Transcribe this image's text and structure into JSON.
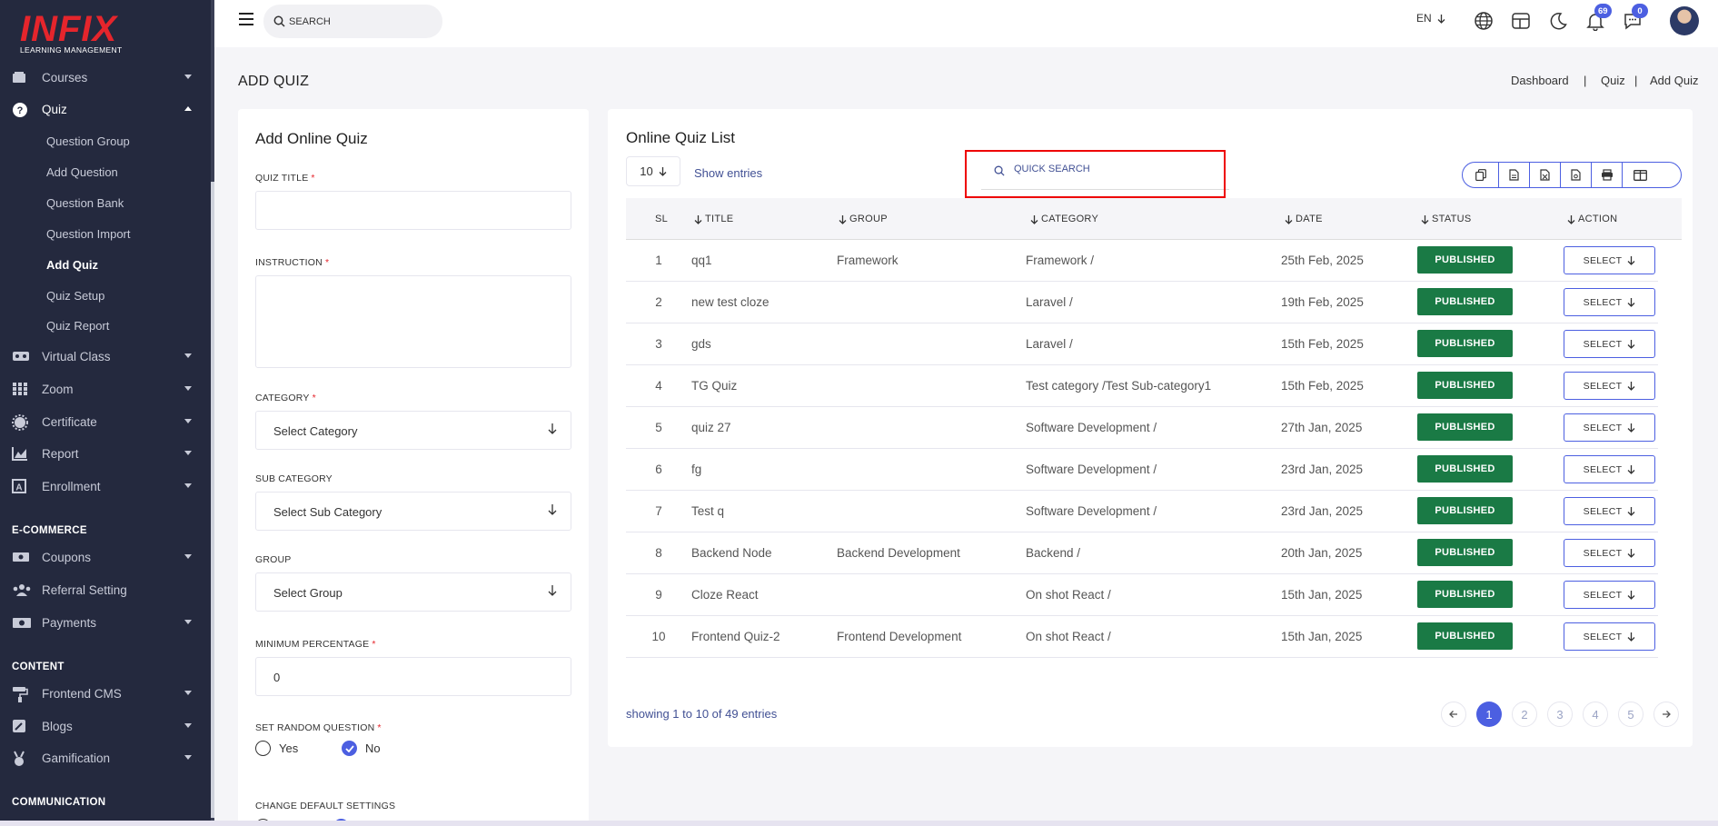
{
  "app": {
    "logo_main": "INFIX",
    "logo_sub": "LEARNING MANAGEMENT"
  },
  "colors": {
    "sidebar_bg": "#24293e",
    "accent": "#4c5fe1",
    "published": "#1a7a45",
    "logo_red": "#e5252c",
    "highlight": "#ee0000"
  },
  "sidebar": {
    "items": [
      {
        "label": "Courses",
        "icon": "courses-icon"
      },
      {
        "label": "Quiz",
        "icon": "quiz-icon",
        "expanded": true
      },
      {
        "label": "Virtual Class",
        "icon": "virtual-class-icon"
      },
      {
        "label": "Zoom",
        "icon": "zoom-icon"
      },
      {
        "label": "Certificate",
        "icon": "certificate-icon"
      },
      {
        "label": "Report",
        "icon": "report-icon"
      },
      {
        "label": "Enrollment",
        "icon": "enrollment-icon"
      },
      {
        "label": "Coupons",
        "icon": "coupons-icon"
      },
      {
        "label": "Referral Setting",
        "icon": "referral-icon"
      },
      {
        "label": "Payments",
        "icon": "payments-icon"
      },
      {
        "label": "Frontend CMS",
        "icon": "frontend-cms-icon"
      },
      {
        "label": "Blogs",
        "icon": "blogs-icon"
      },
      {
        "label": "Gamification",
        "icon": "gamification-icon"
      }
    ],
    "quiz_sub": [
      "Question Group",
      "Add Question",
      "Question Bank",
      "Question Import",
      "Add Quiz",
      "Quiz Setup",
      "Quiz Report"
    ],
    "active_sub": "Add Quiz",
    "sections": {
      "ecommerce": "E-COMMERCE",
      "content": "CONTENT",
      "communication": "COMMUNICATION"
    }
  },
  "header": {
    "search_placeholder": "SEARCH",
    "language": "EN",
    "notifications_count": "69",
    "messages_count": "0"
  },
  "page": {
    "title": "ADD QUIZ",
    "breadcrumb": [
      "Dashboard",
      "Quiz",
      "Add Quiz"
    ],
    "breadcrumb_sep": "|"
  },
  "form": {
    "title": "Add Online Quiz",
    "quiz_title_label": "QUIZ TITLE",
    "instruction_label": "INSTRUCTION",
    "category_label": "CATEGORY",
    "category_value": "Select Category",
    "subcategory_label": "SUB CATEGORY",
    "subcategory_value": "Select Sub Category",
    "group_label": "GROUP",
    "group_value": "Select Group",
    "min_percentage_label": "MINIMUM PERCENTAGE",
    "min_percentage_value": "0",
    "random_label": "SET RANDOM QUESTION",
    "random_yes": "Yes",
    "random_no": "No",
    "random_selected": "No",
    "change_default_label": "CHANGE DEFAULT SETTINGS",
    "required_mark": "*"
  },
  "list": {
    "title": "Online Quiz List",
    "page_length": "10",
    "show_entries": "Show entries",
    "quick_search_placeholder": "QUICK SEARCH",
    "tool_icons": [
      "copy-icon",
      "csv-icon",
      "excel-icon",
      "pdf-icon",
      "print-icon",
      "columns-icon"
    ],
    "columns": [
      "SL",
      "TITLE",
      "GROUP",
      "CATEGORY",
      "DATE",
      "STATUS",
      "ACTION"
    ],
    "rows": [
      {
        "sl": "1",
        "title": "qq1",
        "group": "Framework",
        "category": "Framework /",
        "date": "25th Feb, 2025",
        "status": "PUBLISHED",
        "action": "SELECT"
      },
      {
        "sl": "2",
        "title": "new test cloze",
        "group": "",
        "category": "Laravel /",
        "date": "19th Feb, 2025",
        "status": "PUBLISHED",
        "action": "SELECT"
      },
      {
        "sl": "3",
        "title": "gds",
        "group": "",
        "category": "Laravel /",
        "date": "15th Feb, 2025",
        "status": "PUBLISHED",
        "action": "SELECT"
      },
      {
        "sl": "4",
        "title": "TG Quiz",
        "group": "",
        "category": "Test category /Test Sub-category1",
        "date": "15th Feb, 2025",
        "status": "PUBLISHED",
        "action": "SELECT"
      },
      {
        "sl": "5",
        "title": "quiz 27",
        "group": "",
        "category": "Software Development /",
        "date": "27th Jan, 2025",
        "status": "PUBLISHED",
        "action": "SELECT"
      },
      {
        "sl": "6",
        "title": "fg",
        "group": "",
        "category": "Software Development /",
        "date": "23rd Jan, 2025",
        "status": "PUBLISHED",
        "action": "SELECT"
      },
      {
        "sl": "7",
        "title": "Test q",
        "group": "",
        "category": "Software Development /",
        "date": "23rd Jan, 2025",
        "status": "PUBLISHED",
        "action": "SELECT"
      },
      {
        "sl": "8",
        "title": "Backend Node",
        "group": "Backend Development",
        "category": "Backend /",
        "date": "20th Jan, 2025",
        "status": "PUBLISHED",
        "action": "SELECT"
      },
      {
        "sl": "9",
        "title": "Cloze React",
        "group": "",
        "category": "On shot React /",
        "date": "15th Jan, 2025",
        "status": "PUBLISHED",
        "action": "SELECT"
      },
      {
        "sl": "10",
        "title": "Frontend Quiz-2",
        "group": "Frontend Development",
        "category": "On shot React /",
        "date": "15th Jan, 2025",
        "status": "PUBLISHED",
        "action": "SELECT"
      }
    ],
    "info": "showing 1 to 10 of 49 entries",
    "pages": [
      "1",
      "2",
      "3",
      "4",
      "5"
    ],
    "current_page": "1"
  }
}
